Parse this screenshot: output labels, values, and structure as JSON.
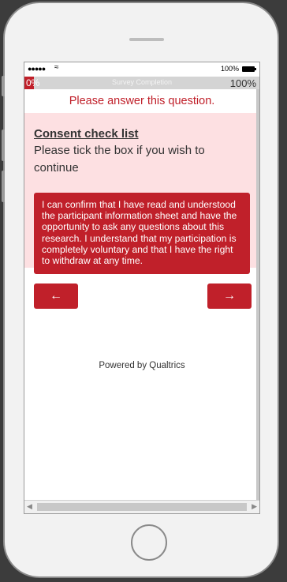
{
  "status_bar": {
    "signal": "●●●●●",
    "wifi": "≈",
    "battery_pct": "100%"
  },
  "progress": {
    "start_label": "0%",
    "label": "Survey Completion",
    "end_label": "100%",
    "value": 0.04
  },
  "validation_message": "Please answer this question.",
  "question": {
    "title": "Consent check list",
    "text": "Please tick the box if you wish to continue",
    "choice": "I can confirm that I have read and understood the participant information sheet and have the opportunity to ask any questions about this research. I understand that my participation is completely voluntary and that I have the right to withdraw at any time."
  },
  "navigation": {
    "back_label": "←",
    "next_label": "→"
  },
  "footer": {
    "powered_by": "Powered by Qualtrics"
  },
  "scrollbar": {
    "left_arrow": "◀",
    "right_arrow": "▶"
  },
  "colors": {
    "accent": "#c0202a",
    "question_bg": "#fde0e2"
  }
}
